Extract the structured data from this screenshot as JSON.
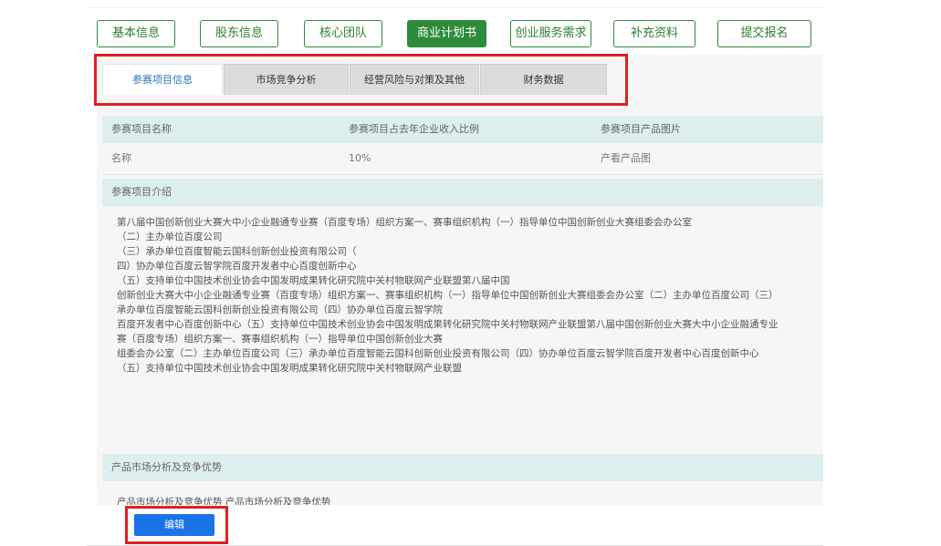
{
  "main_tabs": [
    "基本信息",
    "股东信息",
    "核心团队",
    "商业计划书",
    "创业服务需求",
    "补充资料",
    "提交报名"
  ],
  "sub_tabs": [
    "参赛项目信息",
    "市场竞争分析",
    "经营风险与对策及其他",
    "财务数据"
  ],
  "table": {
    "headers": [
      "参赛项目名称",
      "参赛项目占去年企业收入比例",
      "参赛项目产品图片"
    ],
    "values": [
      "名称",
      "10%",
      "产看产品图"
    ]
  },
  "intro": {
    "title": "参赛项目介绍",
    "lines": [
      "第八届中国创新创业大赛大中小企业融通专业赛（百度专场）组织方案一、赛事组织机构（一）指导单位中国创新创业大赛组委会办公室",
      "（二）主办单位百度公司",
      "（三）承办单位百度智能云国科创新创业投资有限公司（",
      "四）协办单位百度云智学院百度开发者中心百度创新中心",
      "（五）支持单位中国技术创业协会中国发明成果转化研究院中关村物联网产业联盟第八届中国",
      "创新创业大赛大中小企业融通专业赛（百度专场）组织方案一、赛事组织机构（一）指导单位中国创新创业大赛组委会办公室（二）主办单位百度公司（三）",
      "承办单位百度智能云国科创新创业投资有限公司（四）协办单位百度云智学院",
      "百度开发者中心百度创新中心（五）支持单位中国技术创业协会中国发明成果转化研究院中关村物联网产业联盟第八届中国创新创业大赛大中小企业融通专业",
      "赛（百度专场）组织方案一、赛事组织机构（一）指导单位中国创新创业大赛",
      "组委会办公室（二）主办单位百度公司（三）承办单位百度智能云国科创新创业投资有限公司（四）协办单位百度云智学院百度开发者中心百度创新中心",
      "（五）支持单位中国技术创业协会中国发明成果转化研究院中关村物联网产业联盟"
    ]
  },
  "market": {
    "title": "产品市场分析及竞争优势",
    "body": "产品市场分析及竞争优势 产品市场分析及竞争优势"
  },
  "edit_label": "编辑"
}
